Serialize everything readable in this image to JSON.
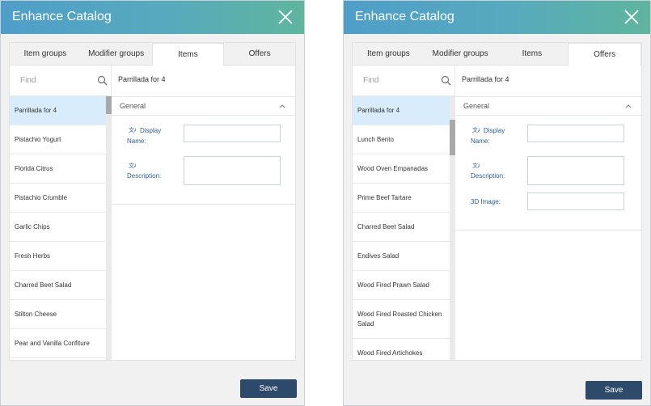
{
  "left_dialog": {
    "title": "Enhance Catalog",
    "tabs": [
      {
        "label": "Item groups"
      },
      {
        "label": "Modifier groups"
      },
      {
        "label": "Items"
      },
      {
        "label": "Offers"
      }
    ],
    "active_tab": "Items",
    "search": {
      "placeholder": "Find"
    },
    "items": [
      {
        "label": "Parrillada for 4"
      },
      {
        "label": "Pistachio Yogurt"
      },
      {
        "label": "Florida Citrus"
      },
      {
        "label": "Pistachio Crumble"
      },
      {
        "label": "Garlic Chips"
      },
      {
        "label": "Fresh Herbs"
      },
      {
        "label": "Charred Beet Salad"
      },
      {
        "label": "Stilton Cheese"
      },
      {
        "label": "Pear and Vanilla Confiture"
      }
    ],
    "selected_item": "Parrillada for 4",
    "detail_title": "Parrillada for 4",
    "section_label": "General",
    "fields": {
      "display_name_label": "Display Name:",
      "display_name_value": "",
      "description_label": "Description:",
      "description_value": ""
    },
    "save_label": "Save"
  },
  "right_dialog": {
    "title": "Enhance Catalog",
    "tabs": [
      {
        "label": "Item groups"
      },
      {
        "label": "Modifier groups"
      },
      {
        "label": "Items"
      },
      {
        "label": "Offers"
      }
    ],
    "active_tab": "Offers",
    "search": {
      "placeholder": "Find"
    },
    "items": [
      {
        "label": "Parrillada for 4"
      },
      {
        "label": "Lunch Bento"
      },
      {
        "label": "Wood Oven Empanadas"
      },
      {
        "label": "Prime Beef Tartare"
      },
      {
        "label": "Charred Beet Salad"
      },
      {
        "label": "Endives Salad"
      },
      {
        "label": "Wood Fired Prawn Salad"
      },
      {
        "label": "Wood Fired Roasted Chicken Salad"
      },
      {
        "label": "Wood Fired Artichokes"
      }
    ],
    "selected_item": "Parrillada for 4",
    "detail_title": "Parrillada for 4",
    "section_label": "General",
    "fields": {
      "display_name_label": "Display Name:",
      "display_name_value": "",
      "description_label": "Description:",
      "description_value": "",
      "image_3d_label": "3D Image:",
      "image_3d_value": ""
    },
    "save_label": "Save"
  },
  "colors": {
    "titlebar_start": "#4f9ec9",
    "titlebar_end": "#5fb59e",
    "selected_row": "#d9ecfb",
    "label_blue": "#2c5f8f",
    "save_button": "#2e4a6b"
  },
  "icons": {
    "close": "close-icon",
    "search": "search-icon",
    "collapse": "chevron-up-icon",
    "translate": "translate-icon"
  }
}
